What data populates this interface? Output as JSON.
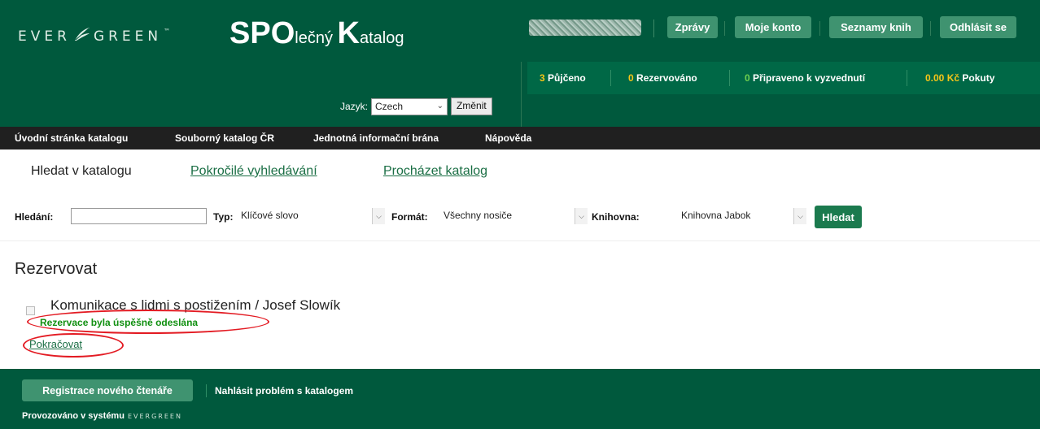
{
  "header": {
    "logo_text_left": "EVER",
    "logo_text_right": "GREEN",
    "logo_tm": "™",
    "brand": {
      "spo": "SPO",
      "lecny": "lečný ",
      "k": "K",
      "atalog": "atalog"
    },
    "buttons": [
      "Zprávy",
      "Moje konto",
      "Seznamy knih",
      "Odhlásit se"
    ],
    "status": {
      "loans_count": "3",
      "loans_label": "Půjčeno",
      "holds_count": "0",
      "holds_label": "Rezervováno",
      "ready_count": "0",
      "ready_label": "Připraveno k vyzvednutí",
      "fines_count": "0.00 Kč",
      "fines_label": "Pokuty"
    },
    "language_label": "Jazyk:",
    "language_value": "Czech",
    "language_button": "Změnit"
  },
  "nav": [
    "Úvodní stránka katalogu",
    "Souborný katalog ČR",
    "Jednotná informační brána",
    "Nápověda"
  ],
  "search_tabs": {
    "active": "Hledat v katalogu",
    "links": [
      "Pokročilé vyhledávání",
      "Procházet katalog"
    ]
  },
  "search": {
    "query_label": "Hledání:",
    "query_value": "",
    "type_label": "Typ:",
    "type_value": "Klíčové slovo",
    "format_label": "Formát:",
    "format_value": "Všechny nosiče",
    "library_label": "Knihovna:",
    "library_value": "Knihovna Jabok",
    "submit": "Hledat"
  },
  "content": {
    "heading": "Rezervovat",
    "record_title": "Komunikace s lidmi s postižením / Josef Slowík",
    "success_message": "Rezervace byla úspěšně odeslána",
    "continue_link": "Pokračovat",
    "highlight_color": "#e31b23"
  },
  "footer": {
    "register_button": "Registrace nového čtenáře",
    "report_link": "Nahlásit problém s katalogem",
    "powered_by": "Provozováno v systému",
    "powered_logo": "EVERGREEN"
  },
  "colors": {
    "header_bg": "#00593d",
    "nav_bg": "#202020",
    "button_bg": "#3f9370",
    "accent_yellow": "#f5c518",
    "success_green": "#119011"
  }
}
